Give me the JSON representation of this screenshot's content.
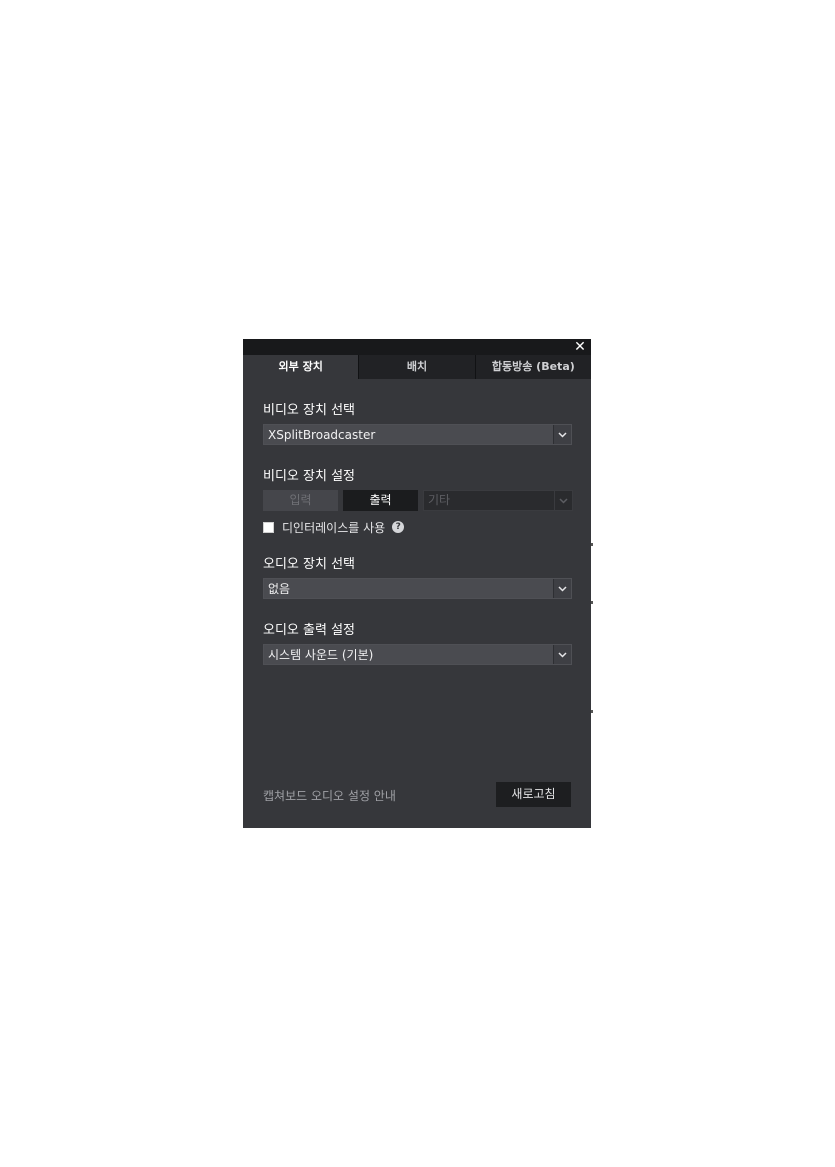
{
  "window": {
    "close_symbol": "✕"
  },
  "tabs": [
    {
      "label": "외부 장치",
      "active": true
    },
    {
      "label": "배치",
      "active": false
    },
    {
      "label": "합동방송 (Beta)",
      "active": false
    }
  ],
  "video_device": {
    "label": "비디오 장치 선택",
    "selected": "XSplitBroadcaster"
  },
  "video_settings": {
    "label": "비디오 장치 설정",
    "input_label": "입력",
    "output_label": "출력",
    "other_label": "기타",
    "deinterlace_label": "디인터레이스를 사용",
    "deinterlace_checked": false,
    "help_symbol": "?"
  },
  "audio_device": {
    "label": "오디오 장치 선택",
    "selected": "없음"
  },
  "audio_output": {
    "label": "오디오 출력 설정",
    "selected": "시스템 사운드 (기본)"
  },
  "footer": {
    "guide_link": "캡쳐보드 오디오 설정 안내",
    "refresh_label": "새로고침"
  },
  "colors": {
    "panel_bg": "#36373b",
    "titlebar_bg": "#18191b",
    "tab_inactive_bg": "#212225",
    "select_bg": "#4a4b50"
  },
  "icons": {
    "close": "close-icon",
    "dropdown": "chevron-down-icon",
    "help": "help-icon"
  }
}
